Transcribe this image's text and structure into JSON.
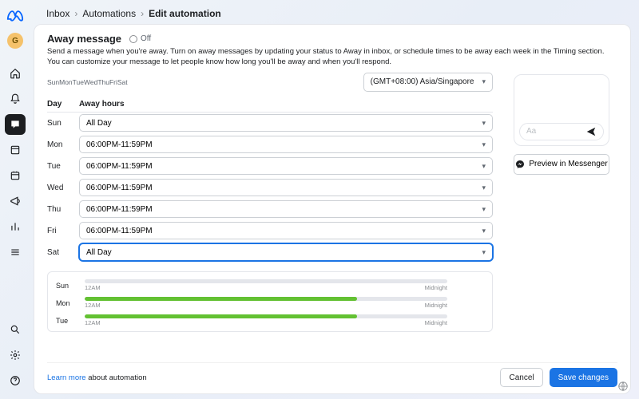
{
  "rail": {
    "avatar_initial": "G"
  },
  "breadcrumb": {
    "a": "Inbox",
    "b": "Automations",
    "c": "Edit automation"
  },
  "header": {
    "title": "Away message",
    "status": "Off",
    "desc": "Send a message when you're away. Turn on away messages by updating your status to Away in inbox, or schedule times to be away each week in the Timing section. You can customize your message to let people know how long you'll be away and when you'll respond."
  },
  "mini_days": "SunMonTueWedThuFriSat",
  "timezone": "(GMT+08:00) Asia/Singapore",
  "columns": {
    "day": "Day",
    "hours": "Away hours"
  },
  "schedule": {
    "sun": {
      "day": "Sun",
      "value": "All Day"
    },
    "mon": {
      "day": "Mon",
      "value": "06:00PM-11:59PM"
    },
    "tue": {
      "day": "Tue",
      "value": "06:00PM-11:59PM"
    },
    "wed": {
      "day": "Wed",
      "value": "06:00PM-11:59PM"
    },
    "thu": {
      "day": "Thu",
      "value": "06:00PM-11:59PM"
    },
    "fri": {
      "day": "Fri",
      "value": "06:00PM-11:59PM"
    },
    "sat": {
      "day": "Sat",
      "value": "All Day"
    }
  },
  "timeline": {
    "start_label": "12AM",
    "end_label": "Midnight",
    "rows": {
      "sun": {
        "day": "Sun",
        "start_pct": 0,
        "width_pct": 0
      },
      "mon": {
        "day": "Mon",
        "start_pct": 0,
        "width_pct": 75
      },
      "tue": {
        "day": "Tue",
        "start_pct": 0,
        "width_pct": 75
      }
    }
  },
  "preview": {
    "placeholder": "Aa",
    "button": "Preview in Messenger"
  },
  "footer": {
    "learn_link": "Learn more",
    "learn_rest": " about automation",
    "cancel": "Cancel",
    "save": "Save changes"
  }
}
